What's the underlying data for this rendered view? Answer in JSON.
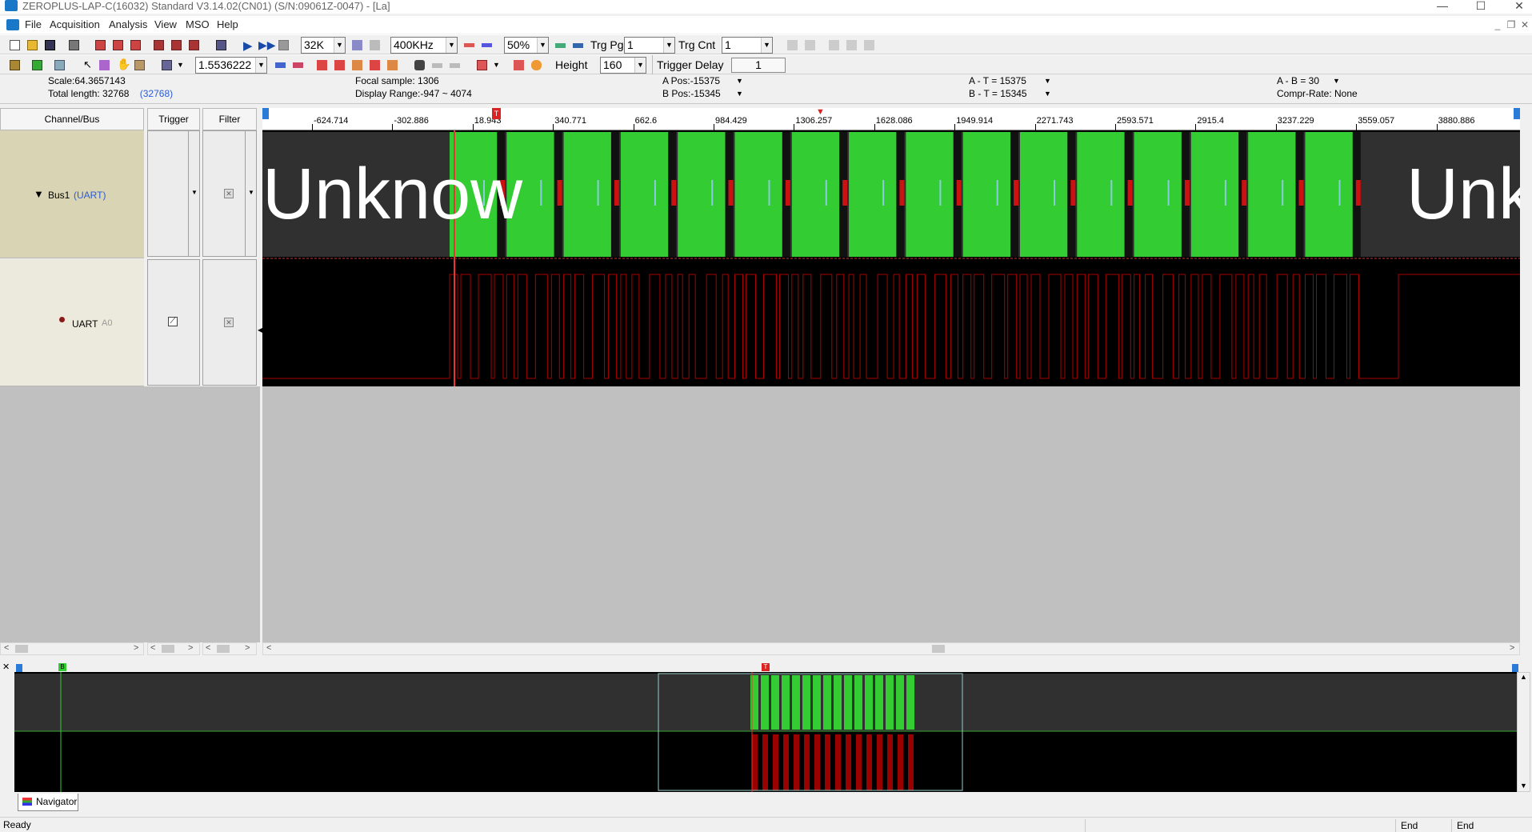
{
  "titlebar": {
    "title": "ZEROPLUS-LAP-C(16032) Standard V3.14.02(CN01) (S/N:09061Z-0047) - [La]",
    "minimize": "—",
    "maximize": "☐",
    "close": "✕"
  },
  "menu": [
    "File",
    "Acquisition",
    "Analysis",
    "View",
    "MSO",
    "Help"
  ],
  "mdi_controls": [
    "_",
    "❐",
    "✕"
  ],
  "toolbar1": {
    "memory_depth": "32K",
    "sample_rate": "400KHz",
    "trigger_pos": "50%",
    "trg_pg_label": "Trg Pg",
    "trg_pg_value": "1",
    "trg_cnt_label": "Trg Cnt",
    "trg_cnt_value": "1"
  },
  "toolbar2": {
    "zoom_value": "1.5536222",
    "height_label": "Height",
    "height_value": "160",
    "trigger_delay_label": "Trigger Delay",
    "trigger_delay_value": "1"
  },
  "info": {
    "scale": "Scale:64.3657143",
    "total_length": "Total length: 32768",
    "total_length_paren": "(32768)",
    "focal_sample": "Focal sample: 1306",
    "display_range": "Display Range:-947 ~ 4074",
    "a_pos": "A Pos:-15375",
    "b_pos": "B Pos:-15345",
    "a_minus_t": "A - T = 15375",
    "b_minus_t": "B - T = 15345",
    "a_minus_b": "A - B = 30",
    "compr_rate": "Compr-Rate: None"
  },
  "columns": {
    "channel_bus": "Channel/Bus",
    "trigger": "Trigger",
    "filter": "Filter"
  },
  "channels": [
    {
      "name": "Bus1",
      "tag": "(UART)"
    },
    {
      "name": "UART",
      "tag": "A0"
    }
  ],
  "ruler_ticks": [
    "-624.714",
    "-302.886",
    "18.943",
    "340.771",
    "662.6",
    "984.429",
    "1306.257",
    "1628.086",
    "1949.914",
    "2271.743",
    "2593.571",
    "2915.4",
    "3237.229",
    "3559.057",
    "3880.886"
  ],
  "bus_decode": {
    "left_label": "Unknow",
    "right_label": "Unk"
  },
  "navigator": {
    "tab_label": "Navigator",
    "marker_t": "T",
    "marker_b": "B"
  },
  "statusbar": {
    "ready": "Ready",
    "end1": "End",
    "end2": "End"
  },
  "colors": {
    "green": "#33cc33",
    "red": "#cc1111",
    "bg_dark": "#303030"
  }
}
